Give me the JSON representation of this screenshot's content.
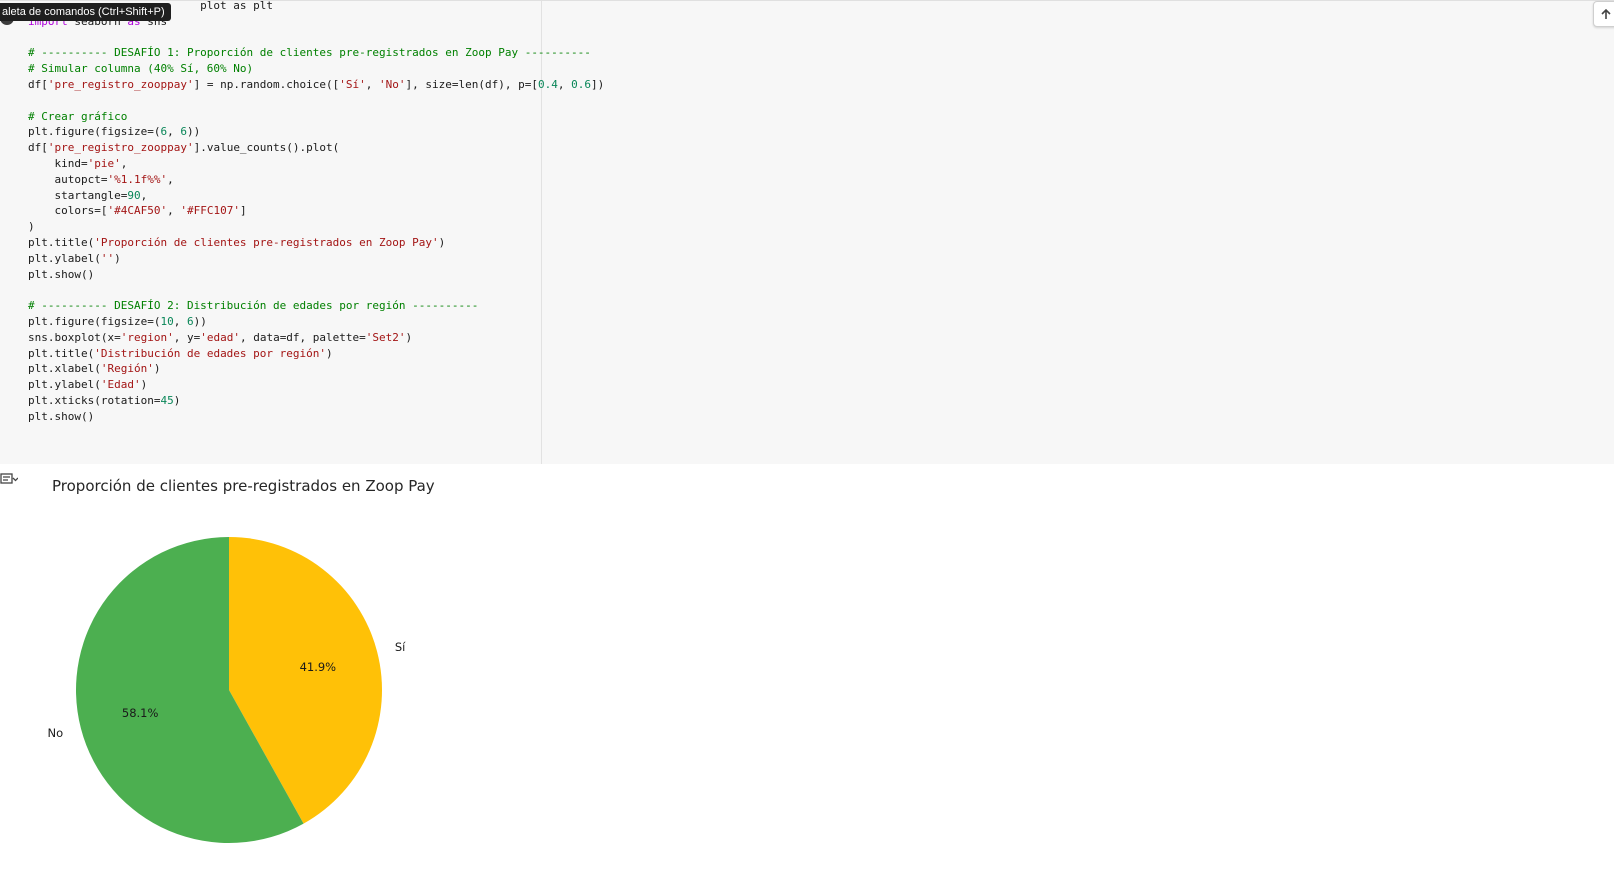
{
  "code_cell": {
    "tooltip": "aleta de comandos (Ctrl+Shift+P)",
    "lines": [
      [
        {
          "t": "plt",
          "c": "",
          "pre": "                          plot as "
        }
      ],
      [
        {
          "t": "import",
          "c": "kw"
        },
        {
          "t": " seaborn ",
          "c": ""
        },
        {
          "t": "as",
          "c": "kw"
        },
        {
          "t": " sns",
          "c": ""
        }
      ],
      [
        {
          "t": "",
          "c": ""
        }
      ],
      [
        {
          "t": "# ---------- DESAFÍO 1: Proporción de clientes pre-registrados en Zoop Pay ----------",
          "c": "com"
        }
      ],
      [
        {
          "t": "# Simular columna (40% Sí, 60% No)",
          "c": "com"
        }
      ],
      [
        {
          "t": "df[",
          "c": ""
        },
        {
          "t": "'pre_registro_zooppay'",
          "c": "str"
        },
        {
          "t": "] = np.random.choice([",
          "c": ""
        },
        {
          "t": "'Sí'",
          "c": "str"
        },
        {
          "t": ", ",
          "c": ""
        },
        {
          "t": "'No'",
          "c": "str"
        },
        {
          "t": "], size=len(df), p=[",
          "c": ""
        },
        {
          "t": "0.4",
          "c": "num"
        },
        {
          "t": ", ",
          "c": ""
        },
        {
          "t": "0.6",
          "c": "num"
        },
        {
          "t": "])",
          "c": ""
        }
      ],
      [
        {
          "t": "",
          "c": ""
        }
      ],
      [
        {
          "t": "# Crear gráfico",
          "c": "com"
        }
      ],
      [
        {
          "t": "plt.figure(figsize=(",
          "c": ""
        },
        {
          "t": "6",
          "c": "num"
        },
        {
          "t": ", ",
          "c": ""
        },
        {
          "t": "6",
          "c": "num"
        },
        {
          "t": "))",
          "c": ""
        }
      ],
      [
        {
          "t": "df[",
          "c": ""
        },
        {
          "t": "'pre_registro_zooppay'",
          "c": "str"
        },
        {
          "t": "].value_counts().plot(",
          "c": ""
        }
      ],
      [
        {
          "t": "    kind=",
          "c": ""
        },
        {
          "t": "'pie'",
          "c": "str"
        },
        {
          "t": ",",
          "c": ""
        }
      ],
      [
        {
          "t": "    autopct=",
          "c": ""
        },
        {
          "t": "'%1.1f%%'",
          "c": "str"
        },
        {
          "t": ",",
          "c": ""
        }
      ],
      [
        {
          "t": "    startangle=",
          "c": ""
        },
        {
          "t": "90",
          "c": "num"
        },
        {
          "t": ",",
          "c": ""
        }
      ],
      [
        {
          "t": "    colors=[",
          "c": ""
        },
        {
          "t": "'#4CAF50'",
          "c": "str"
        },
        {
          "t": ", ",
          "c": ""
        },
        {
          "t": "'#FFC107'",
          "c": "str"
        },
        {
          "t": "]",
          "c": ""
        }
      ],
      [
        {
          "t": ")",
          "c": ""
        }
      ],
      [
        {
          "t": "plt.title(",
          "c": ""
        },
        {
          "t": "'Proporción de clientes pre-registrados en Zoop Pay'",
          "c": "str"
        },
        {
          "t": ")",
          "c": ""
        }
      ],
      [
        {
          "t": "plt.ylabel(",
          "c": ""
        },
        {
          "t": "''",
          "c": "str"
        },
        {
          "t": ")",
          "c": ""
        }
      ],
      [
        {
          "t": "plt.show()",
          "c": ""
        }
      ],
      [
        {
          "t": "",
          "c": ""
        }
      ],
      [
        {
          "t": "# ---------- DESAFÍO 2: Distribución de edades por región ----------",
          "c": "com"
        }
      ],
      [
        {
          "t": "plt.figure(figsize=(",
          "c": ""
        },
        {
          "t": "10",
          "c": "num"
        },
        {
          "t": ", ",
          "c": ""
        },
        {
          "t": "6",
          "c": "num"
        },
        {
          "t": "))",
          "c": ""
        }
      ],
      [
        {
          "t": "sns.boxplot(x=",
          "c": ""
        },
        {
          "t": "'region'",
          "c": "str"
        },
        {
          "t": ", y=",
          "c": ""
        },
        {
          "t": "'edad'",
          "c": "str"
        },
        {
          "t": ", data=df, palette=",
          "c": ""
        },
        {
          "t": "'Set2'",
          "c": "str"
        },
        {
          "t": ")",
          "c": ""
        }
      ],
      [
        {
          "t": "plt.title(",
          "c": ""
        },
        {
          "t": "'Distribución de edades por región'",
          "c": "str"
        },
        {
          "t": ")",
          "c": ""
        }
      ],
      [
        {
          "t": "plt.xlabel(",
          "c": ""
        },
        {
          "t": "'Región'",
          "c": "str"
        },
        {
          "t": ")",
          "c": ""
        }
      ],
      [
        {
          "t": "plt.ylabel(",
          "c": ""
        },
        {
          "t": "'Edad'",
          "c": "str"
        },
        {
          "t": ")",
          "c": ""
        }
      ],
      [
        {
          "t": "plt.xticks(rotation=",
          "c": ""
        },
        {
          "t": "45",
          "c": "num"
        },
        {
          "t": ")",
          "c": ""
        }
      ],
      [
        {
          "t": "plt.show()",
          "c": ""
        }
      ]
    ]
  },
  "icons": {
    "scroll_up": "arrow-up-icon",
    "output_toggle": "output-toggle-icon"
  },
  "chart_data": {
    "type": "pie",
    "title": "Proporción de clientes pre-registrados en Zoop Pay",
    "categories": [
      "Sí",
      "No"
    ],
    "values": [
      41.9,
      58.1
    ],
    "value_labels": [
      "41.9%",
      "58.1%"
    ],
    "colors": [
      "#FFC107",
      "#4CAF50"
    ],
    "startangle": 90
  }
}
